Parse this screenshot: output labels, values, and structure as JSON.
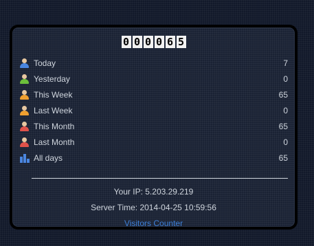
{
  "counter": {
    "digits": [
      "0",
      "0",
      "0",
      "0",
      "6",
      "5"
    ]
  },
  "stats": [
    {
      "label": "Today",
      "value": "7",
      "icon": "person-blue-icon",
      "color": "#4a86e0"
    },
    {
      "label": "Yesterday",
      "value": "0",
      "icon": "person-green-icon",
      "color": "#6cbf3b"
    },
    {
      "label": "This Week",
      "value": "65",
      "icon": "person-orange-icon",
      "color": "#f0a030"
    },
    {
      "label": "Last Week",
      "value": "0",
      "icon": "person-orange-icon",
      "color": "#f0a030"
    },
    {
      "label": "This Month",
      "value": "65",
      "icon": "person-red-icon",
      "color": "#e0524a"
    },
    {
      "label": "Last Month",
      "value": "0",
      "icon": "person-red-icon",
      "color": "#e0524a"
    },
    {
      "label": "All days",
      "value": "65",
      "icon": "bar-chart-icon",
      "color": "#4a86e0"
    }
  ],
  "footer": {
    "ip": "Your IP: 5.203.29.219",
    "server_time": "Server Time: 2014-04-25 10:59:56",
    "link_label": "Visitors Counter"
  }
}
